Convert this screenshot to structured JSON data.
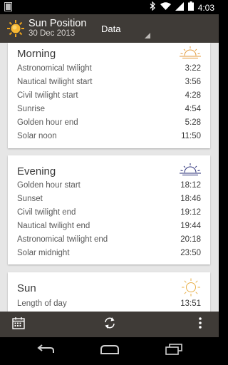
{
  "status_bar": {
    "time": "4:03"
  },
  "app_bar": {
    "title": "Sun Position",
    "subtitle": "30 Dec 2013",
    "spinner_label": "Data"
  },
  "morning": {
    "title": "Morning",
    "rows": [
      {
        "label": "Astronomical twilight",
        "value": "3:22"
      },
      {
        "label": "Nautical twilight start",
        "value": "3:56"
      },
      {
        "label": "Civil twilight start",
        "value": "4:28"
      },
      {
        "label": "Sunrise",
        "value": "4:54"
      },
      {
        "label": "Golden hour end",
        "value": "5:28"
      },
      {
        "label": "Solar noon",
        "value": "11:50"
      }
    ]
  },
  "evening": {
    "title": "Evening",
    "rows": [
      {
        "label": "Golden hour start",
        "value": "18:12"
      },
      {
        "label": "Sunset",
        "value": "18:46"
      },
      {
        "label": "Civil twilight end",
        "value": "19:12"
      },
      {
        "label": "Nautical twilight end",
        "value": "19:44"
      },
      {
        "label": "Astronomical twilight end",
        "value": "20:18"
      },
      {
        "label": "Solar midnight",
        "value": "23:50"
      }
    ]
  },
  "sun": {
    "title": "Sun",
    "rows": [
      {
        "label": "Length of day",
        "value": "13:51"
      }
    ]
  },
  "colors": {
    "bar_bg": "#3f3b37",
    "content_bg": "#e6e6e6",
    "sunrise_icon": "#e39a3b",
    "sunset_icon": "#2a2f7a",
    "sun_icon": "#e8b04a"
  },
  "icons": {
    "app_logo": "sun-logo-icon",
    "morning": "sunrise-icon",
    "evening": "sunset-icon",
    "sun": "sun-icon",
    "calendar": "calendar-icon",
    "refresh": "refresh-icon",
    "overflow": "overflow-menu-icon",
    "back": "back-icon",
    "home": "home-icon",
    "recents": "recents-icon"
  }
}
